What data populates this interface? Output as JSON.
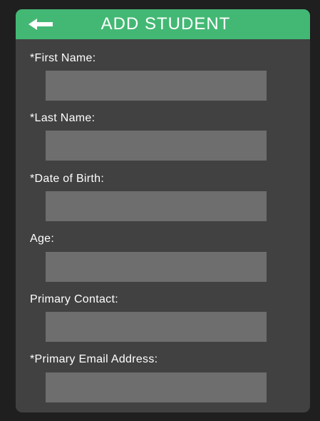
{
  "header": {
    "title": "ADD STUDENT",
    "back_icon": "left-arrow-icon",
    "background_color": "#43b874"
  },
  "form": {
    "fields": [
      {
        "label": "*First Name:",
        "value": "",
        "placeholder": ""
      },
      {
        "label": "*Last Name:",
        "value": "",
        "placeholder": ""
      },
      {
        "label": "*Date of Birth:",
        "value": "",
        "placeholder": ""
      },
      {
        "label": "Age:",
        "value": "",
        "placeholder": ""
      },
      {
        "label": "Primary Contact:",
        "value": "",
        "placeholder": ""
      },
      {
        "label": "*Primary Email Address:",
        "value": "",
        "placeholder": ""
      }
    ]
  },
  "colors": {
    "page_background": "#1f1f1f",
    "card_background": "#414141",
    "input_background": "#6e6e6e",
    "text": "#ffffff"
  }
}
